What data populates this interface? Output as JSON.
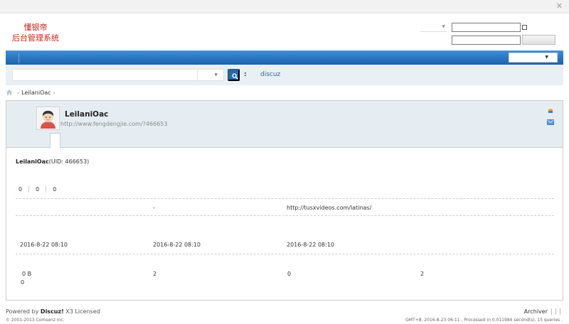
{
  "window": {
    "close_glyph": "✕"
  },
  "header": {
    "logo_line1": "懂银帝",
    "logo_line2": "后台管理系统"
  },
  "search": {
    "colon": ":",
    "hot_link": "discuz"
  },
  "breadcrumb": {
    "items": [
      "LeilaniOac"
    ]
  },
  "profile": {
    "username": "LeilaniOac",
    "home_url": "http://www.fengdengjie.com/?466653",
    "uid_name": "LeilaniOac",
    "uid_text": "(UID: 466653)",
    "stats": [
      "0",
      "0",
      "0"
    ],
    "row1": {
      "col2": "-",
      "col3": "http://tusxvideos.com/latinas/"
    },
    "row2": {
      "col1": "2016-8-22 08:10",
      "col2": "2016-8-22 08:10",
      "col3": "2016-8-22 08:10"
    },
    "row3": {
      "col1": "0 B",
      "col1b": "0",
      "col2": "2",
      "col3": "0",
      "col4": "2"
    }
  },
  "footer": {
    "powered_prefix": "Powered by ",
    "powered_brand": "Discuz!",
    "powered_version": " X3 Licensed",
    "copyright": "© 2001-2013 Comsenz Inc.",
    "archiver": "Archiver",
    "debug": "GMT+8, 2016-8-23 06:11 , Processed in 0.011984 second(s), 15 queries ."
  },
  "colors": {
    "nav_blue": "#1d63ac",
    "logo_red": "#c4241c",
    "search_bg": "#e8eff5",
    "profile_head_bg": "#e5edf2"
  }
}
